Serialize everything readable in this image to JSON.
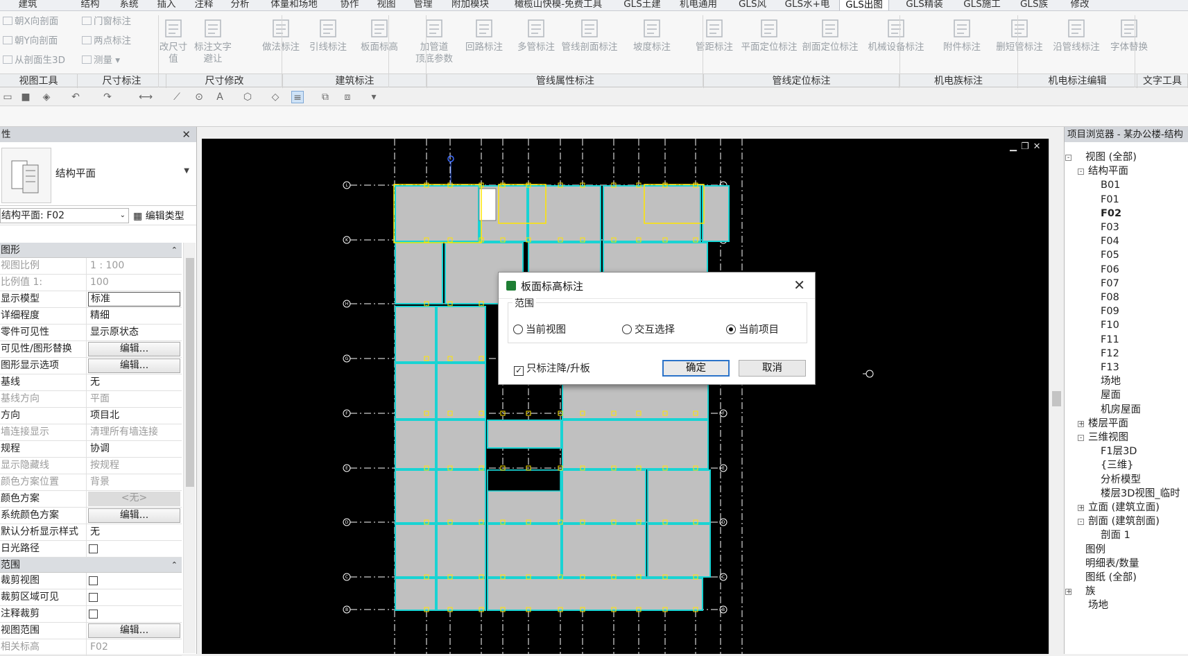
{
  "ribbon": {
    "tabs": [
      "建筑",
      "结构",
      "系统",
      "插入",
      "注释",
      "分析",
      "体量和场地",
      "协作",
      "视图",
      "管理",
      "附加模块",
      "橄榄山快模-免费工具",
      "GLS土建",
      "机电通用",
      "GLS风",
      "GLS水+电",
      "GLS出图",
      "GLS精装",
      "GLS施工",
      "GLS族",
      "修改"
    ],
    "active_tab": "GLS出图",
    "small_tools": [
      "朝X向剖面",
      "朝Y向剖面",
      "从剖面生3D",
      "门窗标注",
      "两点标注",
      "测量"
    ],
    "tools": [
      {
        "label": "改尺寸\n值"
      },
      {
        "label": "标注文字\n避让"
      },
      {
        "label": "做法标注"
      },
      {
        "label": "引线标注"
      },
      {
        "label": "板面标高"
      },
      {
        "label": "加管道\n顶底参数"
      },
      {
        "label": "回路标注"
      },
      {
        "label": "多管标注"
      },
      {
        "label": "管线剖面标注"
      },
      {
        "label": "坡度标注"
      },
      {
        "label": "管距标注"
      },
      {
        "label": "平面定位标注"
      },
      {
        "label": "剖面定位标注"
      },
      {
        "label": "机械设备标注"
      },
      {
        "label": "附件标注"
      },
      {
        "label": "删短管标注"
      },
      {
        "label": "沿管线标注"
      },
      {
        "label": "字体替换"
      }
    ],
    "panels": [
      "视图工具",
      "尺寸标注",
      "尺寸修改",
      "建筑标注",
      "管线属性标注",
      "管线定位标注",
      "机电族标注",
      "机电标注编辑",
      "文字工具"
    ]
  },
  "properties": {
    "title": "性",
    "type_name": "结构平面",
    "instance": "结构平面: F02",
    "edit_type": "编辑类型",
    "sections": [
      {
        "name": "图形",
        "rows": [
          {
            "k": "视图比例",
            "v": "1 : 100",
            "ro": true
          },
          {
            "k": "比例值 1:",
            "v": "100",
            "ro": true
          },
          {
            "k": "显示模型",
            "v": "标准",
            "box": true
          },
          {
            "k": "详细程度",
            "v": "精细"
          },
          {
            "k": "零件可见性",
            "v": "显示原状态"
          },
          {
            "k": "可见性/图形替换",
            "v": "编辑...",
            "btn": true
          },
          {
            "k": "图形显示选项",
            "v": "编辑...",
            "btn": true
          },
          {
            "k": "基线",
            "v": "无"
          },
          {
            "k": "基线方向",
            "v": "平面",
            "ro": true
          },
          {
            "k": "方向",
            "v": "项目北"
          },
          {
            "k": "墙连接显示",
            "v": "清理所有墙连接",
            "ro": true
          },
          {
            "k": "规程",
            "v": "协调"
          },
          {
            "k": "显示隐藏线",
            "v": "按规程",
            "ro": true
          },
          {
            "k": "颜色方案位置",
            "v": "背景",
            "ro": true
          },
          {
            "k": "颜色方案",
            "v": "<无>",
            "dis": true
          },
          {
            "k": "系统颜色方案",
            "v": "编辑...",
            "btn": true
          },
          {
            "k": "默认分析显示样式",
            "v": "无"
          },
          {
            "k": "日光路径",
            "v": "",
            "cb": true
          }
        ]
      },
      {
        "name": "范围",
        "rows": [
          {
            "k": "裁剪视图",
            "v": "",
            "cb": true
          },
          {
            "k": "裁剪区域可见",
            "v": "",
            "cb": true
          },
          {
            "k": "注释裁剪",
            "v": "",
            "cb": true
          },
          {
            "k": "视图范围",
            "v": "编辑...",
            "btn": true
          },
          {
            "k": "相关标高",
            "v": "F02",
            "ro": true
          }
        ]
      }
    ]
  },
  "browser": {
    "title": "项目浏览器 - 某办公楼-结构",
    "nodes": [
      {
        "label": "视图 (全部)",
        "level": 0,
        "exp": "-"
      },
      {
        "label": "结构平面",
        "level": 1,
        "exp": "-"
      },
      {
        "label": "B01",
        "level": 2
      },
      {
        "label": "F01",
        "level": 2
      },
      {
        "label": "F02",
        "level": 2,
        "cur": true
      },
      {
        "label": "F03",
        "level": 2
      },
      {
        "label": "F04",
        "level": 2
      },
      {
        "label": "F05",
        "level": 2
      },
      {
        "label": "F06",
        "level": 2
      },
      {
        "label": "F07",
        "level": 2
      },
      {
        "label": "F08",
        "level": 2
      },
      {
        "label": "F09",
        "level": 2
      },
      {
        "label": "F10",
        "level": 2
      },
      {
        "label": "F11",
        "level": 2
      },
      {
        "label": "F12",
        "level": 2
      },
      {
        "label": "F13",
        "level": 2
      },
      {
        "label": "场地",
        "level": 2
      },
      {
        "label": "屋面",
        "level": 2
      },
      {
        "label": "机房屋面",
        "level": 2
      },
      {
        "label": "楼层平面",
        "level": 1,
        "exp": "+"
      },
      {
        "label": "三维视图",
        "level": 1,
        "exp": "-"
      },
      {
        "label": "F1层3D",
        "level": 2
      },
      {
        "label": "{三维}",
        "level": 2
      },
      {
        "label": "分析模型",
        "level": 2
      },
      {
        "label": "楼层3D视图_临时",
        "level": 2
      },
      {
        "label": "立面 (建筑立面)",
        "level": 1,
        "exp": "+"
      },
      {
        "label": "剖面 (建筑剖面)",
        "level": 1,
        "exp": "-"
      },
      {
        "label": "剖面 1",
        "level": 2
      },
      {
        "label": "图例",
        "level": 0
      },
      {
        "label": "明细表/数量",
        "level": 0
      },
      {
        "label": "图纸 (全部)",
        "level": 0
      },
      {
        "label": "族",
        "level": 0,
        "exp": "+"
      },
      {
        "label": "场地",
        "level": 1
      }
    ]
  },
  "dialog": {
    "title": "板面标高标注",
    "group_label": "范围",
    "options": [
      "当前视图",
      "交互选择",
      "当前项目"
    ],
    "selected": "当前项目",
    "checkbox_label": "只标注降/升板",
    "checkbox_checked": true,
    "ok": "确定",
    "cancel": "取消",
    "close": "✕"
  },
  "canvas": {
    "grid_labels_left": [
      "L",
      "K",
      "H",
      "G",
      "F",
      "E",
      "D",
      "C",
      "B"
    ],
    "grid_labels_right": [
      "L",
      "K",
      "H",
      "G",
      "F",
      "E",
      "D",
      "C",
      "B"
    ],
    "colors": {
      "background": "#000000",
      "slab": "#c0c0c0",
      "beam": "#19d3d3",
      "grid": "#ffffff",
      "selected": "#ffe600"
    }
  }
}
